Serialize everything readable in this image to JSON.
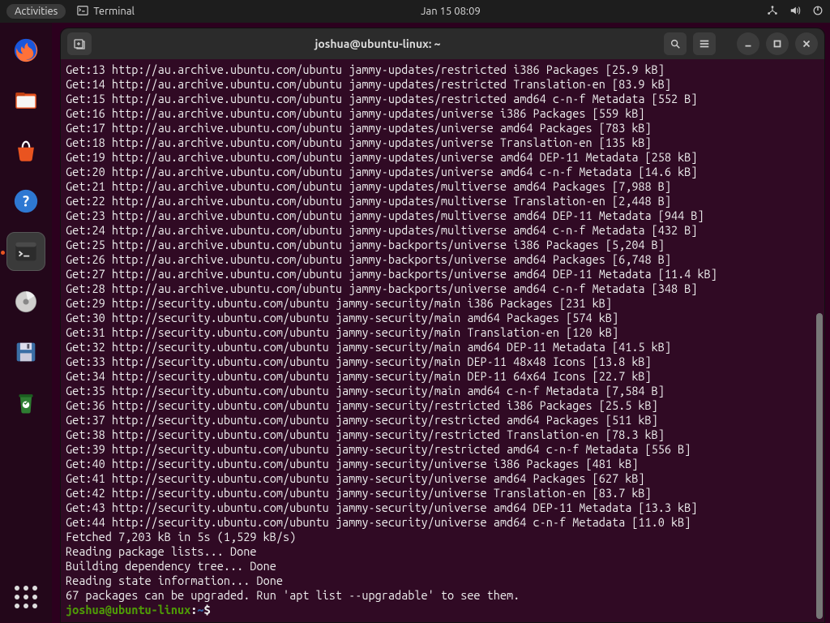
{
  "topbar": {
    "activities": "Activities",
    "app_label": "Terminal",
    "clock": "Jan 15  08:09"
  },
  "dock": {
    "items": [
      {
        "name": "firefox"
      },
      {
        "name": "files"
      },
      {
        "name": "software"
      },
      {
        "name": "help"
      },
      {
        "name": "terminal",
        "running": true,
        "active": true
      },
      {
        "name": "disks"
      },
      {
        "name": "save"
      },
      {
        "name": "trash"
      }
    ]
  },
  "window": {
    "title": "joshua@ubuntu-linux: ~"
  },
  "terminal": {
    "base_archive": "http://au.archive.ubuntu.com/ubuntu",
    "base_security": "http://security.ubuntu.com/ubuntu",
    "lines": [
      {
        "n": 13,
        "src": "archive",
        "suite": "jammy-updates/restricted i386 Packages",
        "size": "25.9 kB"
      },
      {
        "n": 14,
        "src": "archive",
        "suite": "jammy-updates/restricted Translation-en",
        "size": "83.9 kB"
      },
      {
        "n": 15,
        "src": "archive",
        "suite": "jammy-updates/restricted amd64 c-n-f Metadata",
        "size": "552 B"
      },
      {
        "n": 16,
        "src": "archive",
        "suite": "jammy-updates/universe i386 Packages",
        "size": "559 kB"
      },
      {
        "n": 17,
        "src": "archive",
        "suite": "jammy-updates/universe amd64 Packages",
        "size": "783 kB"
      },
      {
        "n": 18,
        "src": "archive",
        "suite": "jammy-updates/universe Translation-en",
        "size": "135 kB"
      },
      {
        "n": 19,
        "src": "archive",
        "suite": "jammy-updates/universe amd64 DEP-11 Metadata",
        "size": "258 kB"
      },
      {
        "n": 20,
        "src": "archive",
        "suite": "jammy-updates/universe amd64 c-n-f Metadata",
        "size": "14.6 kB"
      },
      {
        "n": 21,
        "src": "archive",
        "suite": "jammy-updates/multiverse amd64 Packages",
        "size": "7,988 B"
      },
      {
        "n": 22,
        "src": "archive",
        "suite": "jammy-updates/multiverse Translation-en",
        "size": "2,448 B"
      },
      {
        "n": 23,
        "src": "archive",
        "suite": "jammy-updates/multiverse amd64 DEP-11 Metadata",
        "size": "944 B"
      },
      {
        "n": 24,
        "src": "archive",
        "suite": "jammy-updates/multiverse amd64 c-n-f Metadata",
        "size": "432 B"
      },
      {
        "n": 25,
        "src": "archive",
        "suite": "jammy-backports/universe i386 Packages",
        "size": "5,204 B"
      },
      {
        "n": 26,
        "src": "archive",
        "suite": "jammy-backports/universe amd64 Packages",
        "size": "6,748 B"
      },
      {
        "n": 27,
        "src": "archive",
        "suite": "jammy-backports/universe amd64 DEP-11 Metadata",
        "size": "11.4 kB"
      },
      {
        "n": 28,
        "src": "archive",
        "suite": "jammy-backports/universe amd64 c-n-f Metadata",
        "size": "348 B"
      },
      {
        "n": 29,
        "src": "security",
        "suite": "jammy-security/main i386 Packages",
        "size": "231 kB"
      },
      {
        "n": 30,
        "src": "security",
        "suite": "jammy-security/main amd64 Packages",
        "size": "574 kB"
      },
      {
        "n": 31,
        "src": "security",
        "suite": "jammy-security/main Translation-en",
        "size": "120 kB"
      },
      {
        "n": 32,
        "src": "security",
        "suite": "jammy-security/main amd64 DEP-11 Metadata",
        "size": "41.5 kB"
      },
      {
        "n": 33,
        "src": "security",
        "suite": "jammy-security/main DEP-11 48x48 Icons",
        "size": "13.8 kB"
      },
      {
        "n": 34,
        "src": "security",
        "suite": "jammy-security/main DEP-11 64x64 Icons",
        "size": "22.7 kB"
      },
      {
        "n": 35,
        "src": "security",
        "suite": "jammy-security/main amd64 c-n-f Metadata",
        "size": "7,584 B"
      },
      {
        "n": 36,
        "src": "security",
        "suite": "jammy-security/restricted i386 Packages",
        "size": "25.5 kB"
      },
      {
        "n": 37,
        "src": "security",
        "suite": "jammy-security/restricted amd64 Packages",
        "size": "511 kB"
      },
      {
        "n": 38,
        "src": "security",
        "suite": "jammy-security/restricted Translation-en",
        "size": "78.3 kB"
      },
      {
        "n": 39,
        "src": "security",
        "suite": "jammy-security/restricted amd64 c-n-f Metadata",
        "size": "556 B"
      },
      {
        "n": 40,
        "src": "security",
        "suite": "jammy-security/universe i386 Packages",
        "size": "481 kB"
      },
      {
        "n": 41,
        "src": "security",
        "suite": "jammy-security/universe amd64 Packages",
        "size": "627 kB"
      },
      {
        "n": 42,
        "src": "security",
        "suite": "jammy-security/universe Translation-en",
        "size": "83.7 kB"
      },
      {
        "n": 43,
        "src": "security",
        "suite": "jammy-security/universe amd64 DEP-11 Metadata",
        "size": "13.3 kB"
      },
      {
        "n": 44,
        "src": "security",
        "suite": "jammy-security/universe amd64 c-n-f Metadata",
        "size": "11.0 kB"
      }
    ],
    "tail": [
      "Fetched 7,203 kB in 5s (1,529 kB/s)",
      "Reading package lists... Done",
      "Building dependency tree... Done",
      "Reading state information... Done",
      "67 packages can be upgraded. Run 'apt list --upgradable' to see them."
    ],
    "prompt": {
      "user": "joshua@ubuntu-linux",
      "path": "~",
      "suffix": "$"
    }
  },
  "scrollbar": {
    "thumb_top_pct": 45,
    "thumb_height_pct": 55
  }
}
